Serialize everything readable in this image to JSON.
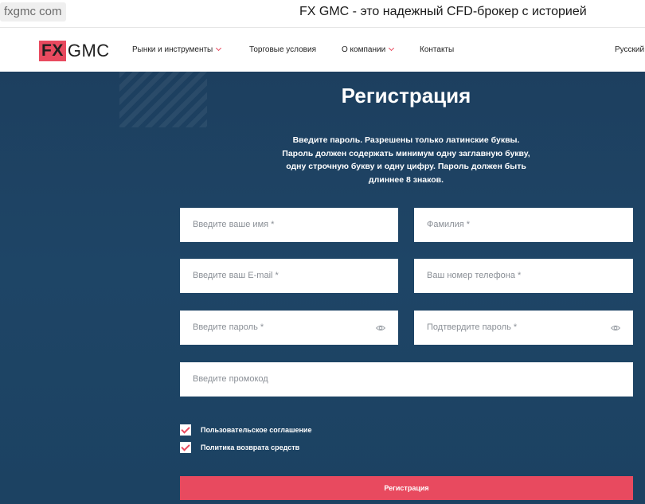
{
  "browser": {
    "url": "fxgmc com",
    "page_title": "FX GMC - это надежный CFD-брокер с историей"
  },
  "header": {
    "logo_fx": "FX",
    "logo_gmc": "GMC",
    "nav": [
      {
        "label": "Рынки и инструменты",
        "has_dropdown": true
      },
      {
        "label": "Торговые условия",
        "has_dropdown": false
      },
      {
        "label": "О компании",
        "has_dropdown": true
      },
      {
        "label": "Контакты",
        "has_dropdown": false
      }
    ],
    "language": "Русский"
  },
  "form": {
    "title": "Регистрация",
    "note": "Введите пароль. Разрешены только латинские буквы. Пароль должен содержать минимум одну заглавную букву, одну строчную букву и одну цифру. Пароль должен быть длиннее 8 знаков.",
    "fields": {
      "first_name": {
        "placeholder": "Введите ваше имя *",
        "value": ""
      },
      "last_name": {
        "placeholder": "Фамилия *",
        "value": ""
      },
      "email": {
        "placeholder": "Введите ваш E-mail *",
        "value": ""
      },
      "phone": {
        "placeholder": "Ваш номер телефона *",
        "value": ""
      },
      "password": {
        "placeholder": "Введите пароль *",
        "value": ""
      },
      "password_confirm": {
        "placeholder": "Подтвердите пароль *",
        "value": ""
      },
      "promo": {
        "placeholder": "Введите промокод",
        "value": ""
      }
    },
    "checkboxes": [
      {
        "label": "Пользовательское соглашение",
        "checked": true
      },
      {
        "label": "Политика возврата средств",
        "checked": true
      }
    ],
    "submit_label": "Регистрация"
  },
  "colors": {
    "accent": "#e84a5f",
    "panel": "#1e4566"
  }
}
